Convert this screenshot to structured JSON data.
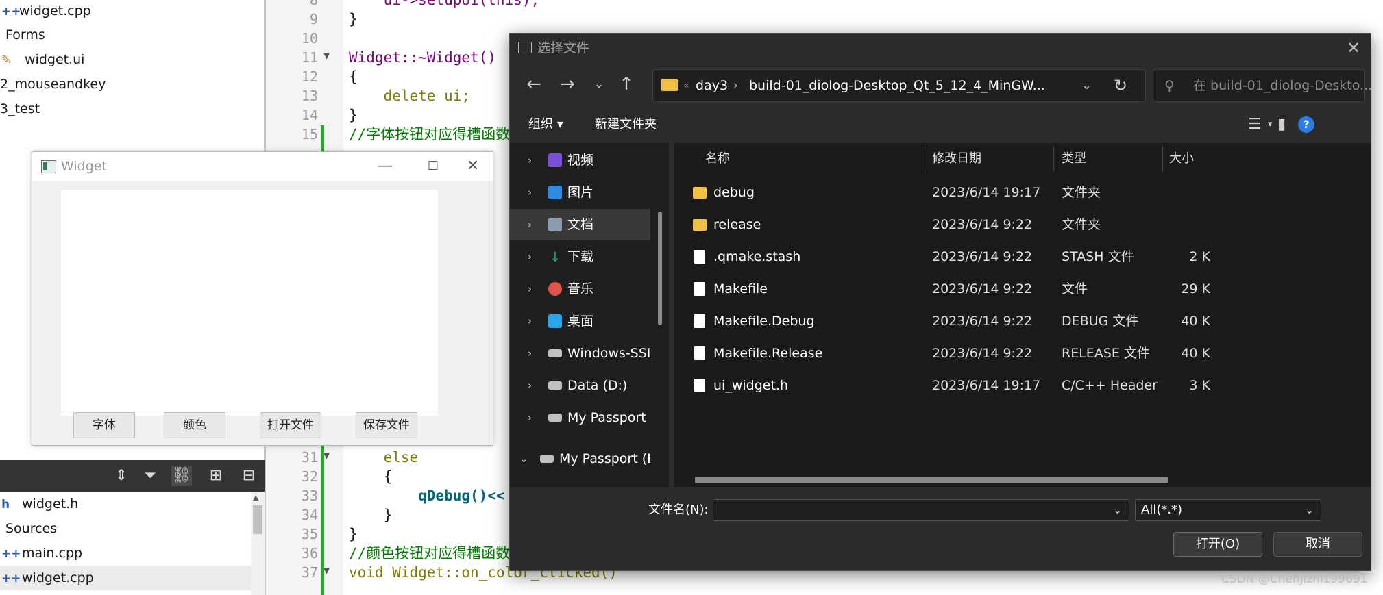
{
  "project_tree": {
    "top_items": [
      {
        "icon": "++",
        "label": "widget.cpp"
      },
      {
        "icon": "",
        "label": "Forms"
      },
      {
        "icon": "✎",
        "label": "widget.ui"
      },
      {
        "icon": "",
        "label": "2_mouseandkey"
      },
      {
        "icon": "",
        "label": "3_test"
      }
    ],
    "bottom_items": [
      {
        "icon": "h",
        "label": "widget.h"
      },
      {
        "icon": "",
        "label": "Sources"
      },
      {
        "icon": "++",
        "label": "main.cpp"
      },
      {
        "icon": "++",
        "label": "widget.cpp"
      }
    ]
  },
  "toolbar_icons": [
    "updown-arrows-icon",
    "filter-icon",
    "link-icon",
    "split-icon",
    "collapse-icon"
  ],
  "code_lines": [
    {
      "num": "8",
      "text": "    ui->setupUi(this);"
    },
    {
      "num": "9",
      "text": "}"
    },
    {
      "num": "10",
      "text": ""
    },
    {
      "num": "11",
      "text": "Widget::~Widget()"
    },
    {
      "num": "12",
      "text": "{"
    },
    {
      "num": "13",
      "text": "    delete ui;"
    },
    {
      "num": "14",
      "text": "}"
    },
    {
      "num": "15",
      "text": "//字体按钮对应得槽函数"
    },
    {
      "num": "31",
      "text": "    else"
    },
    {
      "num": "32",
      "text": "    {"
    },
    {
      "num": "33",
      "text": "        qDebug()<<"
    },
    {
      "num": "34",
      "text": "    }"
    },
    {
      "num": "35",
      "text": "}"
    },
    {
      "num": "36",
      "text": "//颜色按钮对应得槽函数"
    },
    {
      "num": "37",
      "text": "void Widget::on_color_clicked()"
    }
  ],
  "widget_window": {
    "title": "Widget",
    "buttons": [
      "字体",
      "颜色",
      "打开文件",
      "保存文件"
    ]
  },
  "file_dialog": {
    "title": "选择文件",
    "address": {
      "crumbs": [
        "day3",
        "build-01_diolog-Desktop_Qt_5_12_4_MinGW..."
      ]
    },
    "search_placeholder": "在 build-01_diolog-Deskto...",
    "commands": {
      "organize": "组织 ▾",
      "new_folder": "新建文件夹"
    },
    "nav_items": [
      {
        "label": "视频",
        "color": "#7b4fd8",
        "expanded": false
      },
      {
        "label": "图片",
        "color": "#2f8ae0",
        "expanded": false
      },
      {
        "label": "文档",
        "color": "#8a9bb0",
        "expanded": false
      },
      {
        "label": "下载",
        "color": "#1aa37a",
        "expanded": false
      },
      {
        "label": "音乐",
        "color": "#e0544a",
        "expanded": false
      },
      {
        "label": "桌面",
        "color": "#2aa6e8",
        "expanded": false
      },
      {
        "label": "Windows-SSD",
        "color": "#c0c0c0",
        "expanded": false
      },
      {
        "label": "Data (D:)",
        "color": "#c0c0c0",
        "expanded": false
      },
      {
        "label": "My Passport (I",
        "color": "#c0c0c0",
        "expanded": false
      },
      {
        "label": "My Passport (E:",
        "color": "#c0c0c0",
        "expanded": true
      }
    ],
    "selected_nav": "文档",
    "columns": {
      "name": "名称",
      "date": "修改日期",
      "type": "类型",
      "size": "大小"
    },
    "files": [
      {
        "name": "debug",
        "date": "2023/6/14 19:17",
        "type": "文件夹",
        "size": "",
        "kind": "folder"
      },
      {
        "name": "release",
        "date": "2023/6/14 9:22",
        "type": "文件夹",
        "size": "",
        "kind": "folder"
      },
      {
        "name": ".qmake.stash",
        "date": "2023/6/14 9:22",
        "type": "STASH 文件",
        "size": "2 K",
        "kind": "doc"
      },
      {
        "name": "Makefile",
        "date": "2023/6/14 9:22",
        "type": "文件",
        "size": "29 K",
        "kind": "doc"
      },
      {
        "name": "Makefile.Debug",
        "date": "2023/6/14 9:22",
        "type": "DEBUG 文件",
        "size": "40 K",
        "kind": "doc"
      },
      {
        "name": "Makefile.Release",
        "date": "2023/6/14 9:22",
        "type": "RELEASE 文件",
        "size": "40 K",
        "kind": "doc"
      },
      {
        "name": "ui_widget.h",
        "date": "2023/6/14 19:17",
        "type": "C/C++ Header",
        "size": "3 K",
        "kind": "hdr"
      }
    ],
    "filename_label": "文件名(N):",
    "filename_value": "",
    "filter_value": "All(*.*)",
    "open_button": "打开(O)",
    "cancel_button": "取消"
  },
  "watermark": "CSDN @Chenjizhi199691"
}
